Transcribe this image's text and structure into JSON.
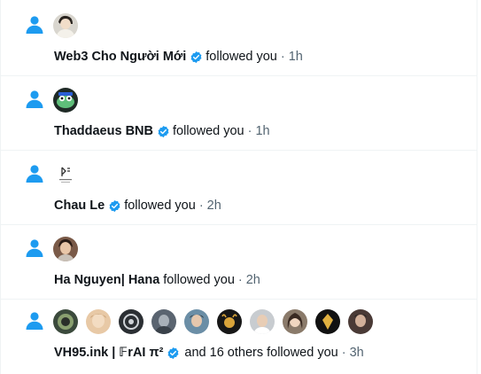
{
  "notifications": [
    {
      "name": "Web3 Cho Người Mới",
      "verified": true,
      "action": "followed you",
      "separator": "·",
      "time": "1h",
      "avatar_color": "#cfcfc9"
    },
    {
      "name": "Thaddaeus BNB",
      "verified": true,
      "action": "followed you",
      "separator": "·",
      "time": "1h",
      "avatar_color": "#2d5a3a"
    },
    {
      "name": "Chau Le",
      "verified": true,
      "action": "followed you",
      "separator": "·",
      "time": "2h",
      "avatar_color": "#ffffff"
    },
    {
      "name": "Ha Nguyen| Hana",
      "verified": false,
      "action": "followed you",
      "separator": "·",
      "time": "2h",
      "avatar_color": "#6b4a3a"
    },
    {
      "name": "VH95.ink | 𝔽rAI π²",
      "verified": true,
      "action": "and 16 others followed you",
      "separator": "·",
      "time": "3h",
      "avatar_colors": [
        "#3b4a3c",
        "#e8c9a6",
        "#2b2f33",
        "#5a6470",
        "#6b8ea6",
        "#171717",
        "#c8ccd0",
        "#8a7a6a",
        "#111111",
        "#4a3a36"
      ]
    }
  ],
  "colors": {
    "accent": "#1d9bf0",
    "text": "#0f1419",
    "secondary": "#536471",
    "divider": "#eff3f4"
  }
}
